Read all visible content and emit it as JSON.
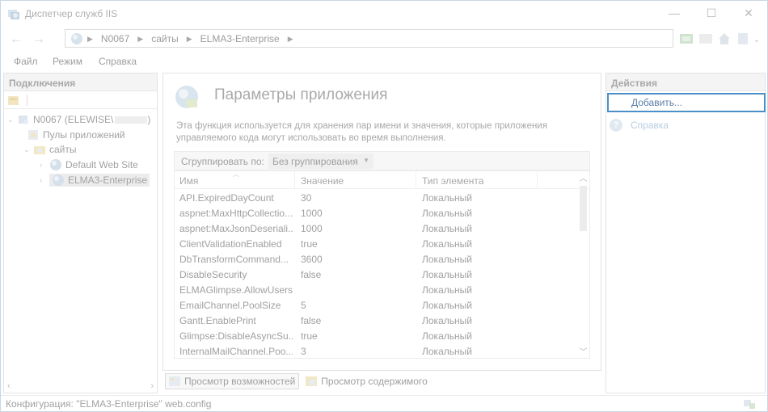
{
  "window": {
    "title": "Диспетчер служб IIS",
    "controls": {
      "minimize": "—",
      "maximize": "☐",
      "close": "✕"
    }
  },
  "address": {
    "crumbs": [
      "N0067",
      "сайты",
      "ELMA3-Enterprise"
    ]
  },
  "menu": {
    "items": [
      "Файл",
      "Режим",
      "Справка"
    ]
  },
  "connections": {
    "header": "Подключения",
    "tree": {
      "server": "N0067 (ELEWISE\\",
      "app_pools": "Пулы приложений",
      "sites": "сайты",
      "site1": "Default Web Site",
      "site2": "ELMA3-Enterprise"
    }
  },
  "feature": {
    "title": "Параметры приложения",
    "description": "Эта функция используется для хранения пар имени и значения, которые приложения управляемого кода могут использовать во время выполнения.",
    "group_label": "Сгруппировать по:",
    "group_value": "Без группирования",
    "columns": [
      "Имя",
      "Значение",
      "Тип элемента"
    ],
    "rows": [
      {
        "name": "API.ExpiredDayCount",
        "value": "30",
        "type": "Локальный"
      },
      {
        "name": "aspnet:MaxHttpCollectio...",
        "value": "1000",
        "type": "Локальный"
      },
      {
        "name": "aspnet:MaxJsonDeseriali...",
        "value": "1000",
        "type": "Локальный"
      },
      {
        "name": "ClientValidationEnabled",
        "value": "true",
        "type": "Локальный"
      },
      {
        "name": "DbTransformCommand...",
        "value": "3600",
        "type": "Локальный"
      },
      {
        "name": "DisableSecurity",
        "value": "false",
        "type": "Локальный"
      },
      {
        "name": "ELMAGlimpse.AllowUsers",
        "value": "",
        "type": "Локальный"
      },
      {
        "name": "EmailChannel.PoolSize",
        "value": "5",
        "type": "Локальный"
      },
      {
        "name": "Gantt.EnablePrint",
        "value": "false",
        "type": "Локальный"
      },
      {
        "name": "Glimpse:DisableAsyncSu...",
        "value": "true",
        "type": "Локальный"
      },
      {
        "name": "InternalMailChannel.Poo...",
        "value": "3",
        "type": "Локальный"
      }
    ],
    "tabs": {
      "features": "Просмотр возможностей",
      "content": "Просмотр содержимого"
    }
  },
  "actions": {
    "header": "Действия",
    "add": "Добавить...",
    "help": "Справка"
  },
  "status": {
    "text": "Конфигурация: \"ELMA3-Enterprise\" web.config"
  },
  "colors": {
    "focus_border": "#4a90c8",
    "link": "#5a7ea8"
  }
}
